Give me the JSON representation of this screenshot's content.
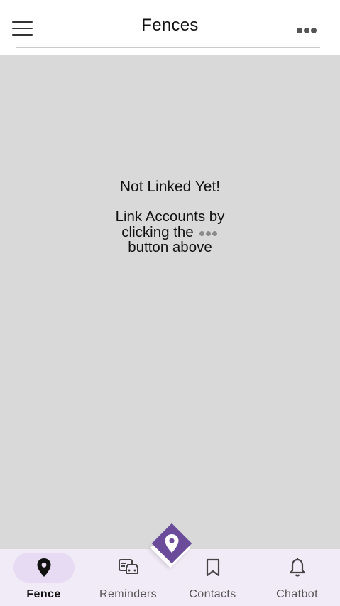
{
  "header": {
    "title": "Fences",
    "menu_icon": "hamburger-menu-icon",
    "more_icon": "more-horizontal-icon"
  },
  "empty_state": {
    "title": "Not Linked Yet!",
    "line1": "Link Accounts by",
    "line2": "clicking the",
    "line3": "button above",
    "inline_icon": "more-horizontal-icon"
  },
  "fab": {
    "icon": "location-pin-icon",
    "color": "#6a4c9b"
  },
  "bottom_nav": {
    "items": [
      {
        "label": "Fence",
        "icon": "location-pin-icon",
        "active": true
      },
      {
        "label": "Reminders",
        "icon": "reminders-icon",
        "active": false
      },
      {
        "label": "Contacts",
        "icon": "bookmark-icon",
        "active": false
      },
      {
        "label": "Chatbot",
        "icon": "bell-icon",
        "active": false
      }
    ]
  },
  "colors": {
    "content_background": "#d9d9d9",
    "nav_background": "#f1ebf7",
    "active_indicator": "#e6dbf2",
    "accent": "#6a4c9b"
  }
}
